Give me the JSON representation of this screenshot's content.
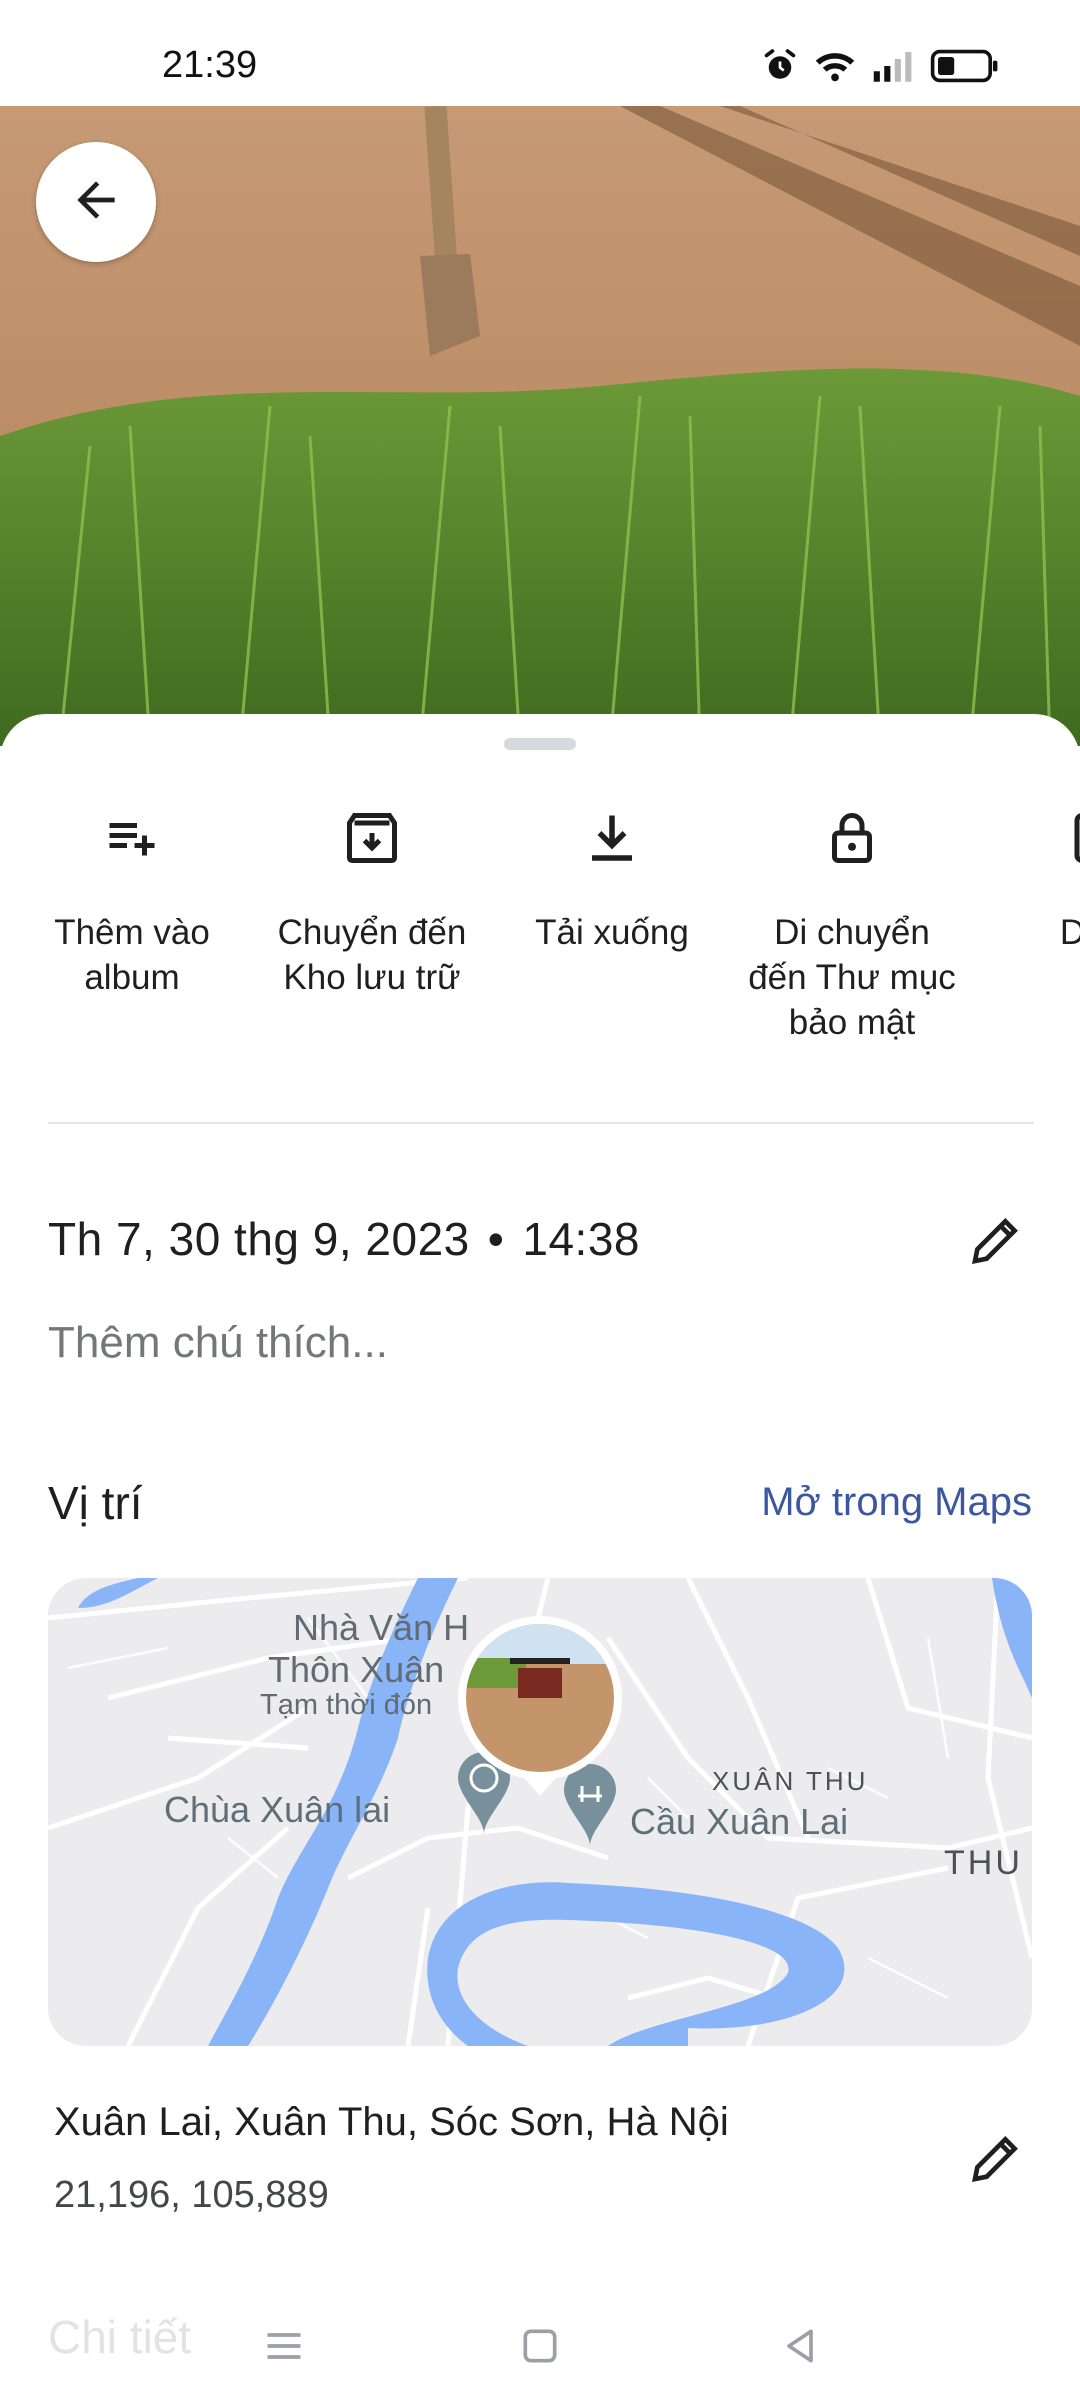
{
  "status_bar": {
    "time": "21:39",
    "icons": [
      "alarm-icon",
      "wifi-icon",
      "signal-icon",
      "battery-icon"
    ]
  },
  "photo": {
    "description_icon": "photo"
  },
  "actions": [
    {
      "icon": "playlist-add-icon",
      "label": "Thêm vào\nalbum"
    },
    {
      "icon": "archive-icon",
      "label": "Chuyển đến\nKho lưu trữ"
    },
    {
      "icon": "download-icon",
      "label": "Tải xuống"
    },
    {
      "icon": "lock-icon",
      "label": "Di chuyển\nđến Thư mục\nbảo mật"
    },
    {
      "icon": "use-as-icon",
      "label": "Dùn"
    }
  ],
  "info": {
    "date": "Th 7, 30 thg 9, 2023",
    "separator": "•",
    "time": "14:38",
    "caption_placeholder": "Thêm chú thích..."
  },
  "location": {
    "title": "Vị trí",
    "open_maps": "Mở trong Maps",
    "address": "Xuân Lai, Xuân Thu, Sóc Sơn, Hà Nội",
    "coordinates": "21,196, 105,889"
  },
  "map": {
    "labels": {
      "nha_van_hoa": "Nhà Văn H",
      "thon_xuan": "Thôn Xuân",
      "tam_thoi_dong": "Tạm thời đón",
      "chua_xuan_lai": "Chùa Xuân lai",
      "cau_xuan_lai": "Cầu Xuân Lai",
      "xuan_thu": "XUÂN THU",
      "thu": "THU"
    },
    "colors": {
      "water": "#8ab4f8",
      "land": "#ececef",
      "pin": "#78909c",
      "road": "#ffffff"
    }
  },
  "details": {
    "title": "Chi tiết"
  },
  "nav": {
    "buttons": [
      "menu-icon",
      "home-icon",
      "back-triangle-icon"
    ]
  }
}
